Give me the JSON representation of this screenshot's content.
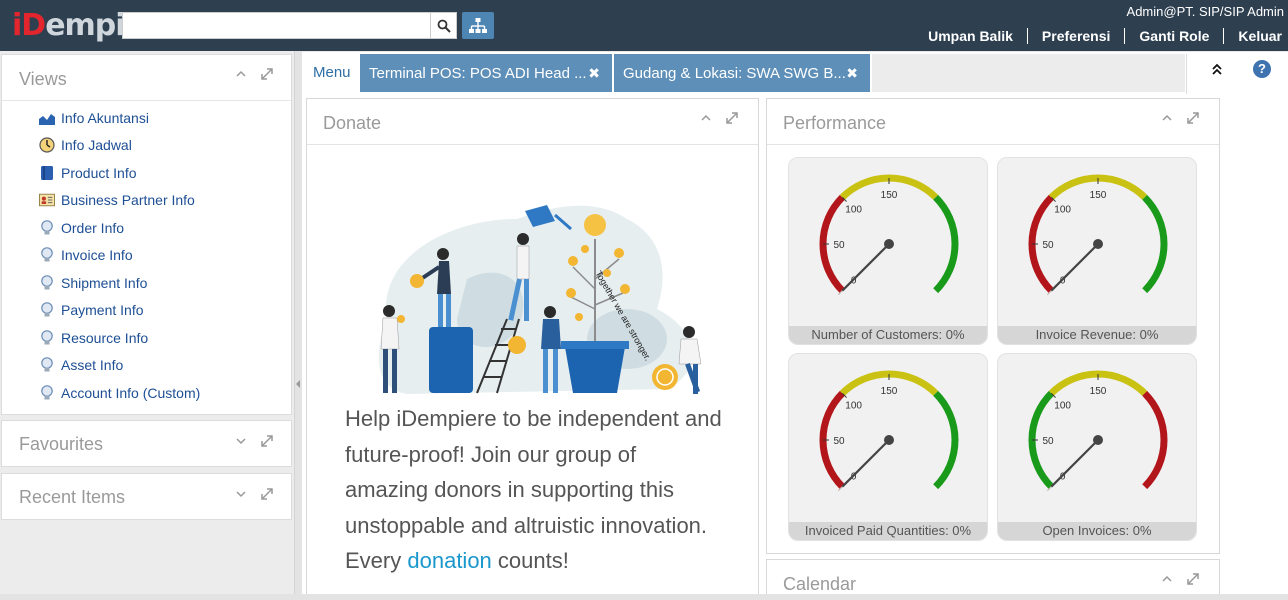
{
  "header": {
    "logo_text": "iDempiere",
    "user_label": "Admin@PT. SIP/SIP Admin",
    "links": [
      "Umpan Balik",
      "Preferensi",
      "Ganti Role",
      "Keluar"
    ],
    "search_value": ""
  },
  "views": {
    "title": "Views",
    "items": [
      {
        "label": "Info Akuntansi",
        "icon": "chart-icon"
      },
      {
        "label": "Info Jadwal",
        "icon": "schedule-icon"
      },
      {
        "label": "Product Info",
        "icon": "product-icon"
      },
      {
        "label": "Business Partner Info",
        "icon": "bpartner-icon"
      },
      {
        "label": "Order Info",
        "icon": "bulb-icon"
      },
      {
        "label": "Invoice Info",
        "icon": "bulb-icon"
      },
      {
        "label": "Shipment Info",
        "icon": "bulb-icon"
      },
      {
        "label": "Payment Info",
        "icon": "bulb-icon"
      },
      {
        "label": "Resource Info",
        "icon": "bulb-icon"
      },
      {
        "label": "Asset Info",
        "icon": "bulb-icon"
      },
      {
        "label": "Account Info (Custom)",
        "icon": "bulb-icon"
      }
    ]
  },
  "favourites": {
    "title": "Favourites"
  },
  "recent": {
    "title": "Recent Items"
  },
  "tabs": [
    {
      "label": "Menu"
    },
    {
      "label": "Terminal POS: POS ADI Head ..."
    },
    {
      "label": "Gudang & Lokasi: SWA SWG B..."
    }
  ],
  "donate": {
    "title": "Donate",
    "illustration_caption": "Together we are stronger.",
    "text_before": "Help iDempiere to be independent and future-proof! Join our group of amazing donors in supporting this unstoppable and altruistic innovation. Every",
    "link": "donation",
    "text_after": " counts!"
  },
  "performance": {
    "title": "Performance",
    "tick_labels": [
      "0",
      "50",
      "100",
      "150"
    ],
    "gauges": [
      {
        "label": "Number of Customers: 0%",
        "value": 0,
        "zones": "red-yellow-green"
      },
      {
        "label": "Invoice Revenue: 0%",
        "value": 0,
        "zones": "red-yellow-green"
      },
      {
        "label": "Invoiced Paid Quantities: 0%",
        "value": 0,
        "zones": "red-yellow-green"
      },
      {
        "label": "Open Invoices: 0%",
        "value": 0,
        "zones": "green-yellow-red"
      }
    ]
  },
  "calendar": {
    "title": "Calendar"
  },
  "colors": {
    "header_bg": "#2e3f50",
    "tab_active_bg": "#5d8fb8",
    "link_blue": "#1e4f95",
    "gauge_red": "#b2161b",
    "gauge_yellow": "#c9c212",
    "gauge_green": "#1a9a1a"
  }
}
